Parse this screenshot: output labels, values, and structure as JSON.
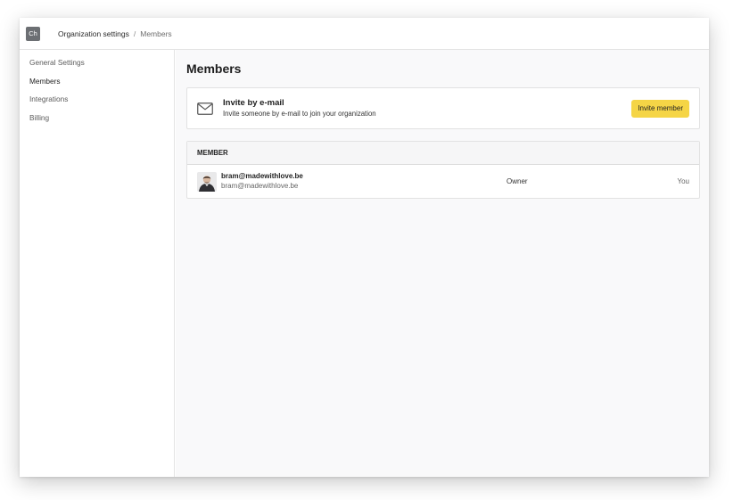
{
  "header": {
    "org_initials": "Ch",
    "breadcrumb": {
      "parent": "Organization settings",
      "separator": "/",
      "current": "Members"
    }
  },
  "sidebar": {
    "items": [
      {
        "label": "General Settings",
        "active": false
      },
      {
        "label": "Members",
        "active": true
      },
      {
        "label": "Integrations",
        "active": false
      },
      {
        "label": "Billing",
        "active": false
      }
    ]
  },
  "main": {
    "title": "Members",
    "invite": {
      "icon": "mail-icon",
      "title": "Invite by e-mail",
      "subtitle": "Invite someone by e-mail to join your organization",
      "button_label": "Invite member"
    },
    "table": {
      "header": "MEMBER",
      "rows": [
        {
          "name": "bram@madewithlove.be",
          "email": "bram@madewithlove.be",
          "role": "Owner",
          "note": "You"
        }
      ]
    }
  },
  "colors": {
    "accent_button": "#f5d546",
    "org_badge": "#6c6f73",
    "main_background": "#f9f9fa"
  }
}
